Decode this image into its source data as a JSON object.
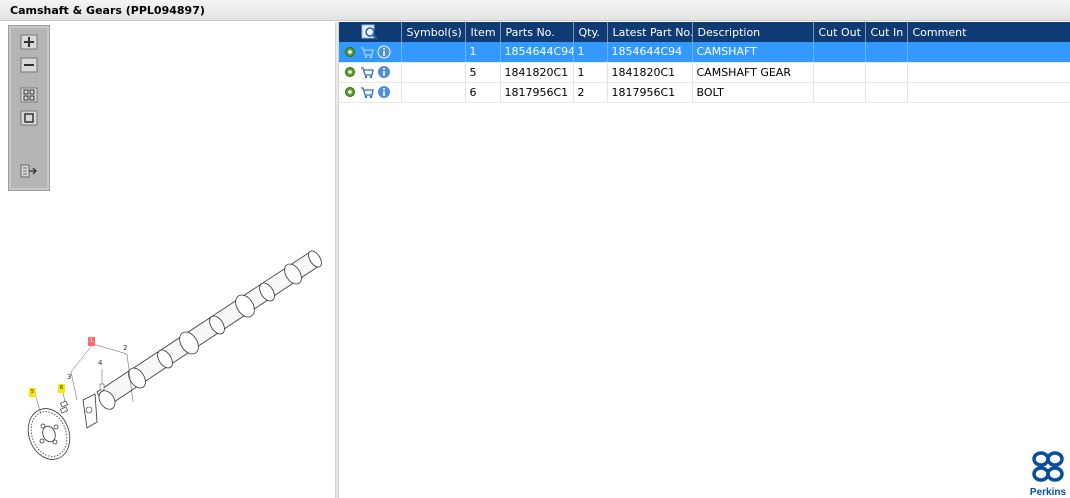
{
  "window": {
    "title": "Camshaft & Gears (PPL094897)"
  },
  "zoom_toolbar": {
    "buttons": [
      {
        "name": "zoom-in",
        "icon": "zoom-in-icon"
      },
      {
        "name": "zoom-out",
        "icon": "zoom-out-icon"
      },
      {
        "name": "fit-all",
        "icon": "fit-all-icon"
      },
      {
        "name": "fit-window",
        "icon": "fit-window-icon"
      },
      {
        "name": "export",
        "icon": "export-icon"
      }
    ]
  },
  "drawing": {
    "callouts": [
      {
        "label": "5",
        "color": "#f5e900"
      },
      {
        "label": "6",
        "color": "#f5e900"
      },
      {
        "label": "1",
        "color": "#ff6b6b"
      }
    ],
    "labels": [
      "2",
      "3",
      "4"
    ]
  },
  "parts_table": {
    "header_icon": "magnifier-icon",
    "columns": [
      "Symbol(s)",
      "Item",
      "Parts No.",
      "Qty.",
      "Latest Part No.",
      "Description",
      "Cut Out",
      "Cut In",
      "Comment"
    ],
    "rows": [
      {
        "item": "1",
        "parts_no": "1854644C94",
        "qty": "1",
        "latest_part_no": "1854644C94",
        "description": "CAMSHAFT",
        "selected": true
      },
      {
        "item": "5",
        "parts_no": "1841820C1",
        "qty": "1",
        "latest_part_no": "1841820C1",
        "description": "CAMSHAFT GEAR",
        "selected": false
      },
      {
        "item": "6",
        "parts_no": "1817956C1",
        "qty": "2",
        "latest_part_no": "1817956C1",
        "description": "BOLT",
        "selected": false
      }
    ],
    "row_actions": [
      "gear-icon",
      "cart-icon",
      "info-icon"
    ]
  },
  "colors": {
    "header_bg": "#0f3b74",
    "selection": "#3399ff",
    "brand": "#0a4ea1"
  },
  "brand": {
    "name": "Perkins"
  }
}
